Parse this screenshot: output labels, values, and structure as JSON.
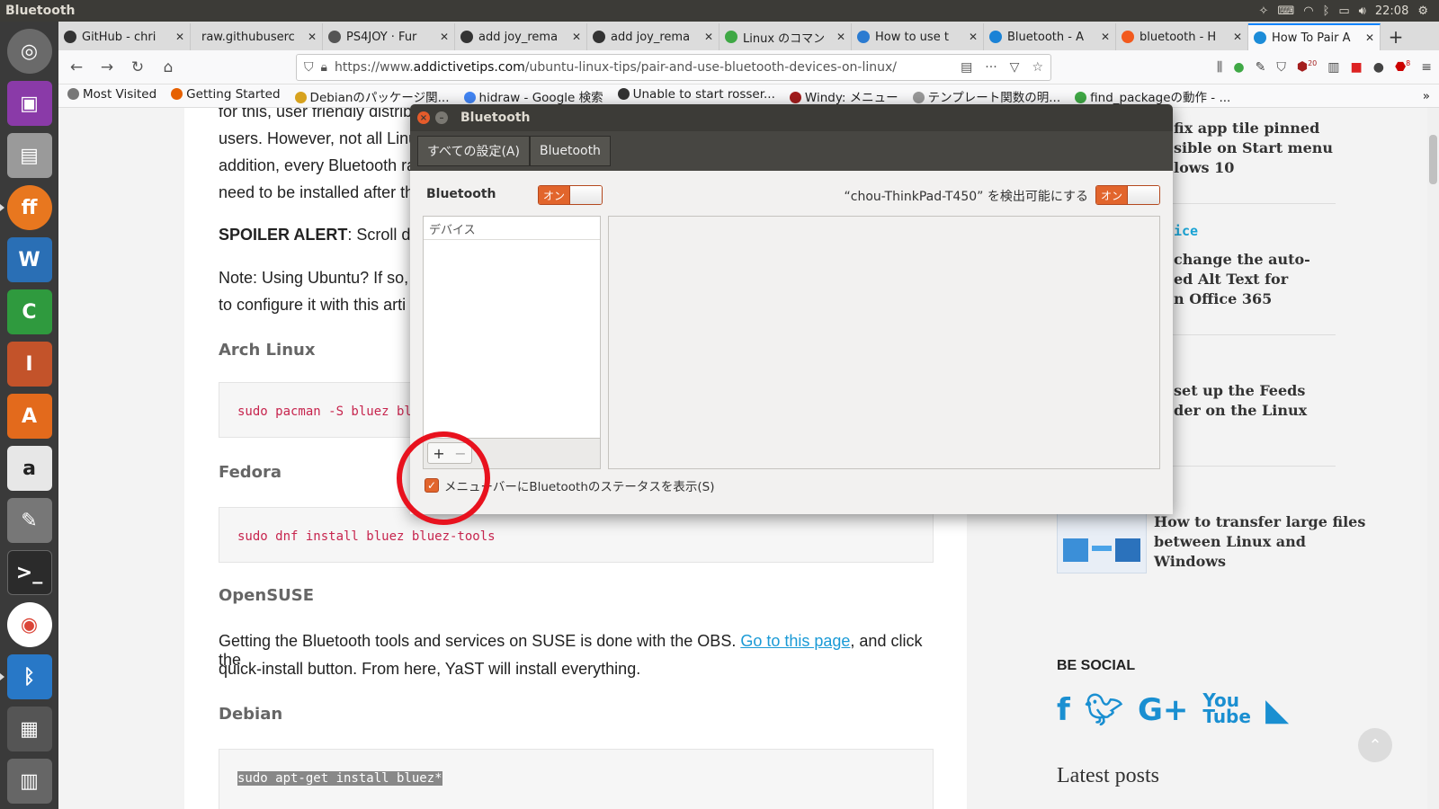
{
  "top_panel": {
    "app_title": "Bluetooth",
    "clock": "22:08"
  },
  "launcher": {
    "apps": [
      "ubuntu-dash",
      "screen-recorder",
      "file-manager",
      "firefox",
      "libreoffice-writer",
      "libreoffice-calc",
      "libreoffice-impress",
      "software-center",
      "amazon",
      "system-settings",
      "terminal",
      "chrome",
      "bluetooth",
      "workspace-switcher",
      "trash"
    ]
  },
  "browser": {
    "tabs": [
      {
        "label": "GitHub - chri",
        "fav": "#333333"
      },
      {
        "label": "raw.githubuserc",
        "fav": ""
      },
      {
        "label": "PS4JOY · Fur",
        "fav": "#555555"
      },
      {
        "label": "add joy_rema",
        "fav": "#333333"
      },
      {
        "label": "add joy_rema",
        "fav": "#333333"
      },
      {
        "label": "Linux のコマン",
        "fav": "#3fa845"
      },
      {
        "label": "How to use t",
        "fav": "#2b7bd1"
      },
      {
        "label": "Bluetooth - A",
        "fav": "#1a82d6"
      },
      {
        "label": "bluetooth - H",
        "fav": "#f25a1e"
      },
      {
        "label": "How To Pair A",
        "fav": "#1c8cd8",
        "active": true
      }
    ],
    "url_prefix": "https://www.",
    "url_domain": "addictivetips.com",
    "url_path": "/ubuntu-linux-tips/pair-and-use-bluetooth-devices-on-linux/",
    "bookmarks": [
      {
        "label": "Most Visited",
        "color": "#777777"
      },
      {
        "label": "Getting Started",
        "color": "#e66000"
      },
      {
        "label": "Debianのパッケージ関...",
        "color": "#d7a21e"
      },
      {
        "label": "hidraw - Google 検索",
        "color": "#4285f4"
      },
      {
        "label": "Unable to start rosser...",
        "color": "#333333"
      },
      {
        "label": "Windy: メニュー",
        "color": "#a31d1d"
      },
      {
        "label": "テンプレート関数の明...",
        "color": "#999999"
      },
      {
        "label": "find_packageの動作 - ...",
        "color": "#3fa845"
      }
    ],
    "badges": {
      "ublock": "20",
      "abp": "8"
    }
  },
  "article": {
    "line1": "for this, user friendly distrib",
    "line2": "users. However, not all Linu",
    "line3": "addition, every Bluetooth ra",
    "line4": "need to be installed after th",
    "spoiler_bold": "SPOILER ALERT",
    "spoiler_rest": ": Scroll dov",
    "note_line1": "Note: Using Ubuntu?  If so,",
    "note_line2": "to configure it with this arti",
    "h_arch": "Arch Linux",
    "code_arch": "sudo pacman -S bluez blu",
    "h_fedora": "Fedora",
    "code_fedora": "sudo dnf install bluez bluez-tools",
    "h_opensuse": "OpenSUSE",
    "suse_text1": "Getting the Bluetooth tools and services on SUSE is done with the OBS. ",
    "suse_link": "Go to this page",
    "suse_text2": ", and click the",
    "suse_text3": "quick-install button. From here, YaST will install everything.",
    "h_debian": "Debian",
    "code_debian": "sudo apt-get install bluez*"
  },
  "sidebar": {
    "item1_l1": "fix app tile pinned",
    "item1_l2": "sible on Start menu",
    "item1_l3": "lows 10",
    "category": "ice",
    "item2_l1": "change the auto-",
    "item2_l2": "ed Alt Text for",
    "item2_l3": "n Office 365",
    "item3_l1": "set up the Feeds",
    "item3_l2": "der on the Linux",
    "item4_l1": "How to transfer large files",
    "item4_l2": "between Linux and",
    "item4_l3": "Windows",
    "be_social": "BE SOCIAL",
    "latest": "Latest posts"
  },
  "dialog": {
    "title": "Bluetooth",
    "crumb_all": "すべての設定(A)",
    "crumb_bt": "Bluetooth",
    "bt_label": "Bluetooth",
    "switch_on": "オン",
    "discoverable_label": "“chou-ThinkPad-T450” を検出可能にする",
    "devices_header": "デバイス",
    "add_btn": "+",
    "remove_btn": "−",
    "show_status_label": "メニューバーにBluetoothのステータスを表示(S)",
    "show_status_checked": true
  }
}
